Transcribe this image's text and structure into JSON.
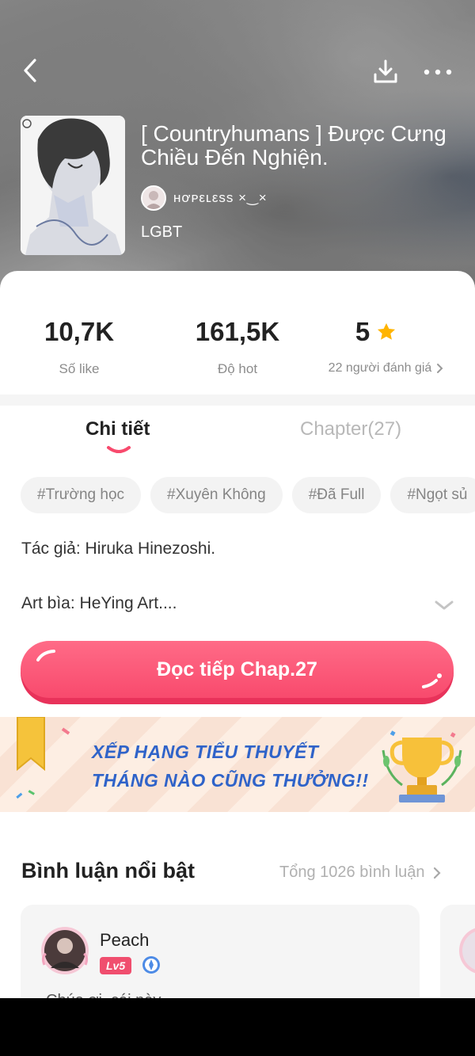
{
  "header": {
    "title": "[ Countryhumans ] Được Cưng Chiều Đến Nghiện.",
    "author": "ʜơᴘεʟεss ×‿×",
    "genre": "LGBT",
    "icons": {
      "back": "back-arrow-icon",
      "download": "download-icon",
      "more": "more-dots-icon"
    }
  },
  "stats": {
    "likes_value": "10,7K",
    "likes_label": "Số like",
    "hot_value": "161,5K",
    "hot_label": "Độ hot",
    "rating_value": "5",
    "rating_label": "22 người đánh giá"
  },
  "tabs": {
    "detail": "Chi tiết",
    "chapter": "Chapter(27)"
  },
  "tags": [
    "#Trường học",
    "#Xuyên Không",
    "#Đã Full",
    "#Ngọt sủ"
  ],
  "info": {
    "author_line": "Tác giả: Hiruka Hinezoshi.",
    "art_line": "Art bìa: HeYing Art...."
  },
  "read_button": "Đọc tiếp Chap.27",
  "banner": {
    "line1": "XẾP HẠNG TIỂU THUYẾT",
    "line2": "THÁNG NÀO CŨNG THƯỞNG!!"
  },
  "comments": {
    "heading": "Bình luận nổi bật",
    "total": "Tổng 1026 bình luận",
    "first": {
      "name": "Peach",
      "level": "Lv5",
      "text": "Chúa ơi, cái này ..."
    }
  },
  "colors": {
    "accent": "#f84a6d",
    "star": "#ffb400",
    "banner_text": "#2f63c9"
  }
}
